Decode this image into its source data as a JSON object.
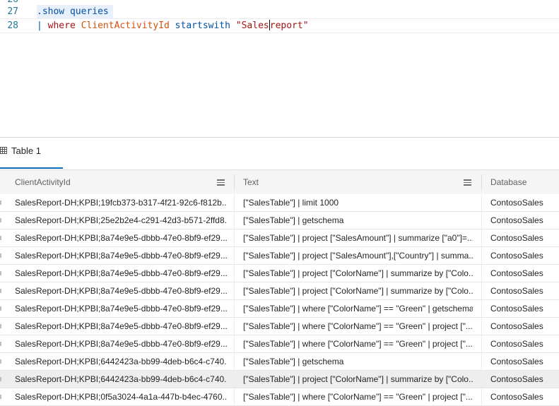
{
  "editor": {
    "lines": [
      {
        "number": "26",
        "tokens": []
      },
      {
        "number": "27",
        "tokens": [
          {
            "text": ".show queries",
            "kind": "kw"
          }
        ]
      },
      {
        "number": "28",
        "tokens": [
          {
            "text": "| ",
            "kind": "pipe"
          },
          {
            "text": "where",
            "kind": "op"
          },
          {
            "text": " ",
            "kind": "plain"
          },
          {
            "text": "ClientActivityId",
            "kind": "fn"
          },
          {
            "text": " startswith ",
            "kind": "kw"
          },
          {
            "text": "\"Sales",
            "kind": "str"
          },
          {
            "text": "report\"",
            "kind": "str"
          }
        ]
      }
    ],
    "colors": {
      "keyword": "#0451a5",
      "operator": "#a31515",
      "column": "#d1510d",
      "string": "#a31515",
      "line_number": "#237893"
    }
  },
  "results": {
    "tab": {
      "label": "Table 1",
      "icon": "table-grid-icon"
    },
    "columns": [
      {
        "label": "ClientActivityId",
        "has_menu": true
      },
      {
        "label": "Text",
        "has_menu": true
      },
      {
        "label": "Database",
        "has_menu": false
      }
    ],
    "rows": [
      {
        "client": "SalesReport-DH;KPBI;19fcb373-b317-4f21-92c6-f812b...",
        "text": "[\"SalesTable\"] | limit 1000",
        "db": "ContosoSales"
      },
      {
        "client": "SalesReport-DH;KPBI;25e2b2e4-c291-42d3-b571-2ffd8...",
        "text": "[\"SalesTable\"] | getschema",
        "db": "ContosoSales"
      },
      {
        "client": "SalesReport-DH;KPBI;8a74e9e5-dbbb-47e0-8bf9-ef29...",
        "text": "[\"SalesTable\"] | project [\"SalesAmount\"] | summarize [\"a0\"]=...",
        "db": "ContosoSales"
      },
      {
        "client": "SalesReport-DH;KPBI;8a74e9e5-dbbb-47e0-8bf9-ef29...",
        "text": "[\"SalesTable\"] | project [\"SalesAmount\"],[\"Country\"] | summa...",
        "db": "ContosoSales"
      },
      {
        "client": "SalesReport-DH;KPBI;8a74e9e5-dbbb-47e0-8bf9-ef29...",
        "text": "[\"SalesTable\"] | project [\"ColorName\"] | summarize by [\"Colo...",
        "db": "ContosoSales"
      },
      {
        "client": "SalesReport-DH;KPBI;8a74e9e5-dbbb-47e0-8bf9-ef29...",
        "text": "[\"SalesTable\"] | project [\"ColorName\"] | summarize by [\"Colo...",
        "db": "ContosoSales"
      },
      {
        "client": "SalesReport-DH;KPBI;8a74e9e5-dbbb-47e0-8bf9-ef29...",
        "text": "[\"SalesTable\"] | where [\"ColorName\"] == \"Green\" | getschema",
        "db": "ContosoSales"
      },
      {
        "client": "SalesReport-DH;KPBI;8a74e9e5-dbbb-47e0-8bf9-ef29...",
        "text": "[\"SalesTable\"] | where [\"ColorName\"] == \"Green\" | project [\"...",
        "db": "ContosoSales"
      },
      {
        "client": "SalesReport-DH;KPBI;8a74e9e5-dbbb-47e0-8bf9-ef29...",
        "text": "[\"SalesTable\"] | where [\"ColorName\"] == \"Green\" | project [\"...",
        "db": "ContosoSales"
      },
      {
        "client": "SalesReport-DH;KPBI;6442423a-bb99-4deb-b6c4-c740...",
        "text": "[\"SalesTable\"] | getschema",
        "db": "ContosoSales"
      },
      {
        "client": "SalesReport-DH;KPBI;6442423a-bb99-4deb-b6c4-c740...",
        "text": "[\"SalesTable\"] | project [\"ColorName\"] | summarize by [\"Colo...",
        "db": "ContosoSales",
        "selected": true
      },
      {
        "client": "SalesReport-DH;KPBI;0f5a3024-4a1a-447b-b4ec-4760...",
        "text": "[\"SalesTable\"] | where [\"ColorName\"] == \"Green\" | project [\"...",
        "db": "ContosoSales"
      }
    ]
  }
}
